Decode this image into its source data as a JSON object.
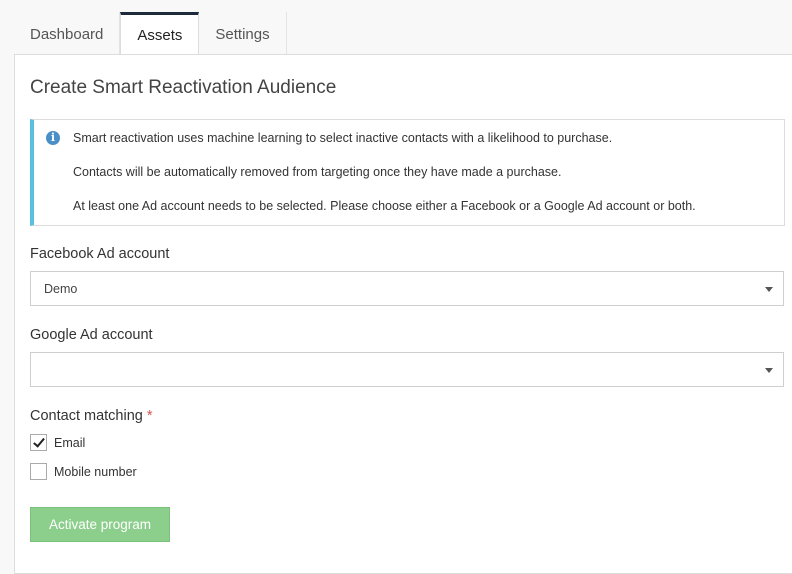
{
  "tabs": [
    {
      "label": "Dashboard",
      "active": false
    },
    {
      "label": "Assets",
      "active": true
    },
    {
      "label": "Settings",
      "active": false
    }
  ],
  "page": {
    "title": "Create Smart Reactivation Audience"
  },
  "info": {
    "icon": "info-icon",
    "lines": [
      "Smart reactivation uses machine learning to select inactive contacts with a likelihood to purchase.",
      "Contacts will be automatically removed from targeting once they have made a purchase.",
      "At least one Ad account needs to be selected. Please choose either a Facebook or a Google Ad account or both."
    ]
  },
  "facebook": {
    "label": "Facebook Ad account",
    "selected": "Demo"
  },
  "google": {
    "label": "Google Ad account",
    "selected": ""
  },
  "contact_matching": {
    "label": "Contact matching",
    "required_marker": "*",
    "options": [
      {
        "label": "Email",
        "checked": true
      },
      {
        "label": "Mobile number",
        "checked": false
      }
    ]
  },
  "actions": {
    "activate_label": "Activate program"
  },
  "colors": {
    "info_accent": "#5bc0de",
    "active_tab_border": "#1c2a3a",
    "button_bg": "#8ccf8c",
    "required": "#d9534f"
  }
}
